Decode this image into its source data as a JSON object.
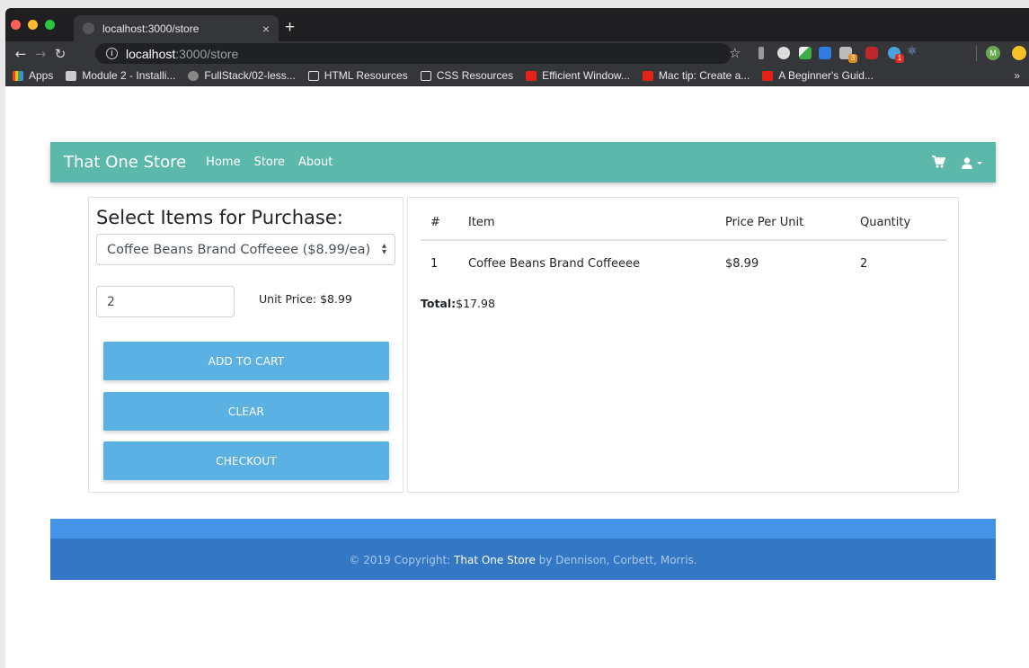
{
  "browser": {
    "tab_title": "localhost:3000/store",
    "tab_close": "×",
    "new_tab": "+",
    "url_host": "localhost",
    "url_path": ":3000/store",
    "bookmarks": [
      {
        "label": "Apps",
        "icon": "apps-grid-icon"
      },
      {
        "label": "Module 2 - Installi...",
        "icon": "document-icon"
      },
      {
        "label": "FullStack/02-less...",
        "icon": "github-icon"
      },
      {
        "label": "HTML Resources",
        "icon": "folder-icon"
      },
      {
        "label": "CSS Resources",
        "icon": "folder-icon"
      },
      {
        "label": "Efficient Window...",
        "icon": "youtube-icon"
      },
      {
        "label": "Mac tip: Create a...",
        "icon": "youtube-icon"
      },
      {
        "label": "A Beginner's Guid...",
        "icon": "youtube-icon"
      }
    ],
    "bookmarks_more": "»",
    "extension_badge_1": "3",
    "extension_badge_2": "1",
    "profile_initial": "M"
  },
  "navbar": {
    "brand": "That One Store",
    "links": [
      "Home",
      "Store",
      "About"
    ],
    "accent_color": "#5cb8ab"
  },
  "purchase": {
    "title": "Select Items for Purchase:",
    "selected_product": "Coffee Beans Brand Coffeeee ($8.99/ea)",
    "quantity": "2",
    "unit_price": "Unit Price: $8.99",
    "buttons": {
      "add": "ADD TO CART",
      "clear": "CLEAR",
      "checkout": "CHECKOUT"
    },
    "button_color": "#5bb2e2"
  },
  "cart": {
    "headers": [
      "#",
      "Item",
      "Price Per Unit",
      "Quantity"
    ],
    "rows": [
      {
        "num": "1",
        "item": "Coffee Beans Brand Coffeeee",
        "price": "$8.99",
        "qty": "2"
      }
    ],
    "total_label": "Total:",
    "total_value": "$17.98"
  },
  "footer": {
    "prefix": "© 2019 Copyright: ",
    "brand": "That One Store",
    "suffix": " by Dennison, Corbett, Morris.",
    "color": "#3478c5"
  }
}
